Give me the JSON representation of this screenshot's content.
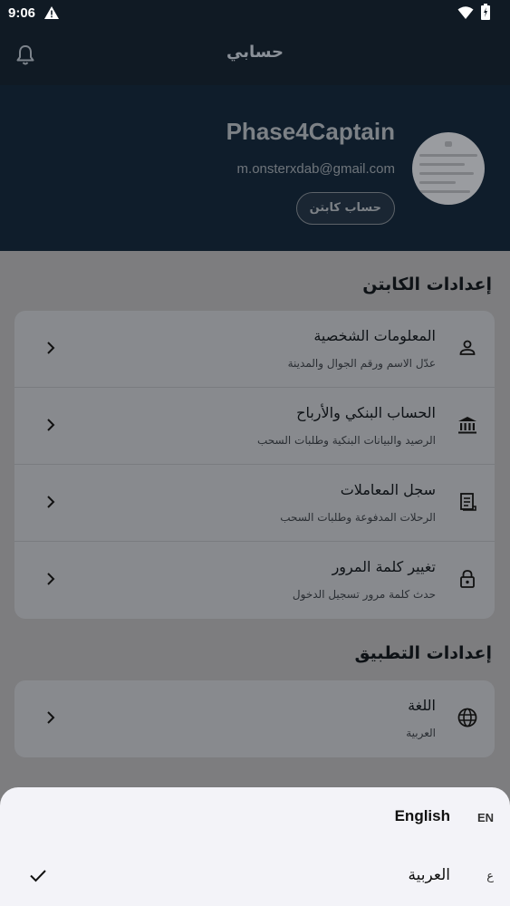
{
  "status": {
    "time": "9:06"
  },
  "appbar": {
    "title": "حسابي"
  },
  "profile": {
    "name": "Phase4Captain",
    "email": "m.onsterxdab@gmail.com",
    "badge": "حساب كابتن"
  },
  "captain_settings": {
    "title": "إعدادات الكابتن",
    "items": [
      {
        "title": "المعلومات الشخصية",
        "subtitle": "عدّل الاسم ورقم الجوال والمدينة",
        "icon": "person-icon"
      },
      {
        "title": "الحساب البنكي والأرباح",
        "subtitle": "الرصيد والبيانات البنكية وطلبات السحب",
        "icon": "bank-icon"
      },
      {
        "title": "سجل المعاملات",
        "subtitle": "الرحلات المدفوعة وطلبات السحب",
        "icon": "receipt-icon"
      },
      {
        "title": "تغيير كلمة المرور",
        "subtitle": "حدث كلمة مرور تسجيل الدخول",
        "icon": "lock-icon"
      }
    ]
  },
  "app_settings": {
    "title": "إعدادات التطبيق",
    "items": [
      {
        "title": "اللغة",
        "subtitle": "العربية",
        "icon": "globe-icon"
      }
    ]
  },
  "language_sheet": {
    "options": [
      {
        "name": "English",
        "code": "EN",
        "selected": false
      },
      {
        "name": "العربية",
        "code": "ع",
        "selected": true
      }
    ]
  },
  "colors": {
    "header_bg": "#0f1d2b",
    "overlay_bg": "#7d7d7f",
    "sheet_bg": "#f3f3f8"
  }
}
